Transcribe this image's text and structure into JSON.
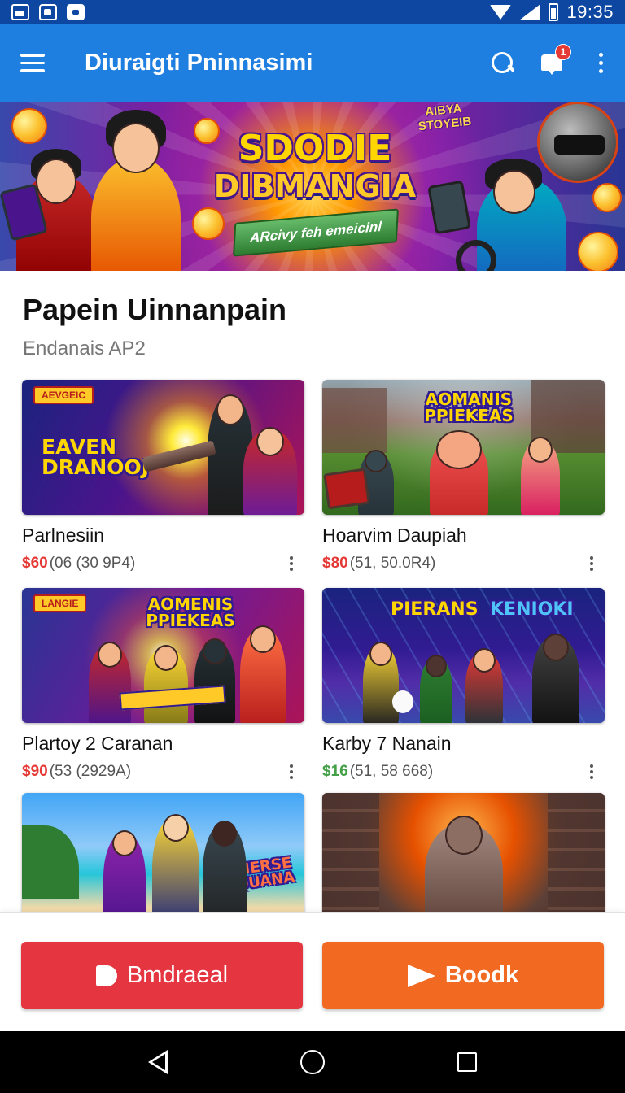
{
  "status_bar": {
    "time": "19:35"
  },
  "app_bar": {
    "title": "Diuraigti Pninnasimi",
    "notification_count": "1"
  },
  "banner": {
    "title_line1": "SDODIE",
    "title_line2": "DIBMANGIA",
    "ribbon": "ARcivy feh emeicinl",
    "badge": "AIBYA STOYEIB"
  },
  "section": {
    "title": "Papein Uinnanpain",
    "subtitle": "Endanais AP2"
  },
  "games": [
    {
      "name": "Parlnesiin",
      "price": "$60",
      "meta": "(06 (30 9P4)",
      "price_color": "red",
      "thumb_label": "EAVEN DRANOOJ",
      "thumb_tag": "AEVGEIC"
    },
    {
      "name": "Hoarvim Daupiah",
      "price": "$80",
      "meta": "(51, 50.0R4)",
      "price_color": "red",
      "thumb_label": "AOMANIS PPIEKEAS"
    },
    {
      "name": "Plartoy 2 Caranan",
      "price": "$90",
      "meta": "(53 (2929A)",
      "price_color": "red",
      "thumb_label": "AOMENIS PPIEKEAS",
      "thumb_tag": "LANGIE"
    },
    {
      "name": "Karby 7 Nanain",
      "price": "$16",
      "meta": "(51, 58 668)",
      "price_color": "green",
      "thumb_label": "PIERANS",
      "thumb_label2": "KENIOKI"
    },
    {
      "name": "",
      "price": "",
      "meta": "",
      "thumb_label": "MERSE QUANA"
    },
    {
      "name": "",
      "price": "",
      "meta": "",
      "thumb_label": ""
    }
  ],
  "actions": {
    "primary": "Bmdraeal",
    "secondary": "Boodk"
  },
  "colors": {
    "app_bar": "#1e7fe0",
    "status_bar": "#0d47a1",
    "primary_button": "#e53540",
    "secondary_button": "#f26a21",
    "price_red": "#e53935",
    "price_green": "#43a047"
  }
}
